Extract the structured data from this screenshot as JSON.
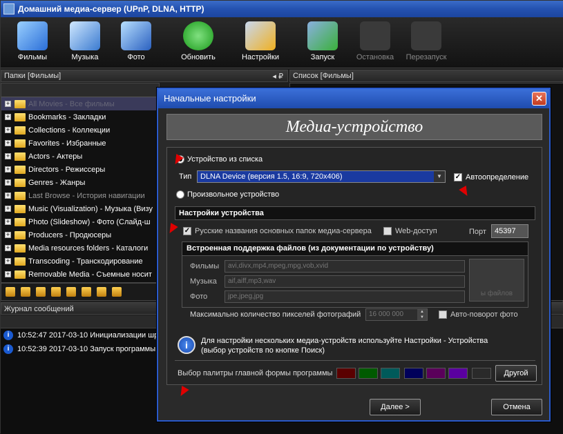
{
  "window": {
    "title": "Домашний медиа-сервер (UPnP, DLNA, HTTP)"
  },
  "toolbar": {
    "films": "Фильмы",
    "music": "Музыка",
    "photo": "Фото",
    "refresh": "Обновить",
    "settings": "Настройки",
    "start": "Запуск",
    "stop": "Остановка",
    "restart": "Перезапуск"
  },
  "left_pane": {
    "title": "Папки [Фильмы]",
    "pin": "◂ ₽"
  },
  "right_pane": {
    "title": "Список [Фильмы]"
  },
  "tree": {
    "items": [
      {
        "label": "All Movies - Все фильмы"
      },
      {
        "label": "Bookmarks - Закладки"
      },
      {
        "label": "Collections - Коллекции"
      },
      {
        "label": "Favorites - Избранные"
      },
      {
        "label": "Actors - Актеры"
      },
      {
        "label": "Directors - Режиссеры"
      },
      {
        "label": "Genres - Жанры"
      },
      {
        "label": "Last Browse - История навигации"
      },
      {
        "label": "Music (Visualization) - Музыка (Визу"
      },
      {
        "label": "Photo (Slideshow) - Фото (Слайд-ш"
      },
      {
        "label": "Producers - Продюсеры"
      },
      {
        "label": "Media resources folders - Каталоги"
      },
      {
        "label": "Transcoding - Транскодирование"
      },
      {
        "label": "Removable Media - Съемные носит"
      }
    ]
  },
  "journal": {
    "title": "Журнал сообщений",
    "rows": [
      {
        "text": "10:52:47 2017-03-10 Инициализации шрі"
      },
      {
        "text": "10:52:39 2017-03-10 Запуск программы"
      }
    ]
  },
  "dialog": {
    "title": "Начальные настройки",
    "close": "✕",
    "banner": "Медиа-устройство",
    "radio_list": "Устройство из списка",
    "type_label": "Тип",
    "device_value": "DLNA Device (версия 1.5, 16:9, 720x406)",
    "auto_detect": "Автоопределение",
    "radio_custom": "Произвольное устройство",
    "section_title": "Настройки устройства",
    "russian_names": "Русские названия основных папок медиа-сервера",
    "web_access": "Web-доступ",
    "port_label": "Порт",
    "port_value": "45397",
    "support_title": "Встроенная поддержка файлов (из документации по устройству)",
    "films_label": "Фильмы",
    "films_value": "avi,divx,mp4,mpeg,mpg,vob,xvid",
    "music_label": "Музыка",
    "music_value": "aif,aiff,mp3,wav",
    "photo_label": "Фото",
    "photo_value": "jpe,jpeg,jpg",
    "thumb_text": "ы файлов",
    "max_pixels_label": "Максимально количество пикселей фотографий",
    "max_pixels_value": "16 000 000",
    "auto_rotate": "Авто-поворот фото",
    "info_line1": "Для настройки нескольких медиа-устройств используйте Настройки - Устройства",
    "info_line2": "(выбор устройств по кнопке Поиск)",
    "palette_label": "Выбор палитры главной формы программы",
    "palette_colors": [
      "#5a0000",
      "#005a00",
      "#005a5a",
      "#00005a",
      "#5a005a",
      "#5a00a0",
      "#2a2a2a"
    ],
    "other_button": "Другой",
    "next_button": "Далее >",
    "cancel_button": "Отмена"
  }
}
